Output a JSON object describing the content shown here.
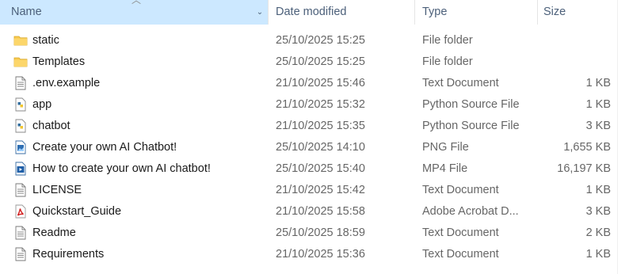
{
  "columns": {
    "name": "Name",
    "date": "Date modified",
    "type": "Type",
    "size": "Size"
  },
  "files": [
    {
      "name": "static",
      "date": "25/10/2025 15:25",
      "type": "File folder",
      "size": "",
      "icon": "folder-icon"
    },
    {
      "name": "Templates",
      "date": "25/10/2025 15:25",
      "type": "File folder",
      "size": "",
      "icon": "folder-icon"
    },
    {
      "name": ".env.example",
      "date": "21/10/2025 15:46",
      "type": "Text Document",
      "size": "1 KB",
      "icon": "text-document-icon"
    },
    {
      "name": "app",
      "date": "21/10/2025 15:32",
      "type": "Python Source File",
      "size": "1 KB",
      "icon": "python-file-icon"
    },
    {
      "name": "chatbot",
      "date": "21/10/2025 15:35",
      "type": "Python Source File",
      "size": "3 KB",
      "icon": "python-file-icon"
    },
    {
      "name": "Create your own AI Chatbot!",
      "date": "25/10/2025 14:10",
      "type": "PNG File",
      "size": "1,655 KB",
      "icon": "image-file-icon"
    },
    {
      "name": "How to create your own AI chatbot!",
      "date": "25/10/2025 15:40",
      "type": "MP4 File",
      "size": "16,197 KB",
      "icon": "video-file-icon"
    },
    {
      "name": "LICENSE",
      "date": "21/10/2025 15:42",
      "type": "Text Document",
      "size": "1 KB",
      "icon": "text-document-icon"
    },
    {
      "name": "Quickstart_Guide",
      "date": "21/10/2025 15:58",
      "type": "Adobe Acrobat D...",
      "size": "3 KB",
      "icon": "pdf-file-icon"
    },
    {
      "name": "Readme",
      "date": "25/10/2025 18:59",
      "type": "Text Document",
      "size": "2 KB",
      "icon": "text-document-icon"
    },
    {
      "name": "Requirements",
      "date": "21/10/2025 15:36",
      "type": "Text Document",
      "size": "1 KB",
      "icon": "text-document-icon"
    }
  ],
  "colors": {
    "header_selected_bg": "#cce8ff",
    "header_text": "#4c607a",
    "folder": "#f8c950",
    "python": "#3670a0",
    "pdf": "#d11f1f"
  }
}
